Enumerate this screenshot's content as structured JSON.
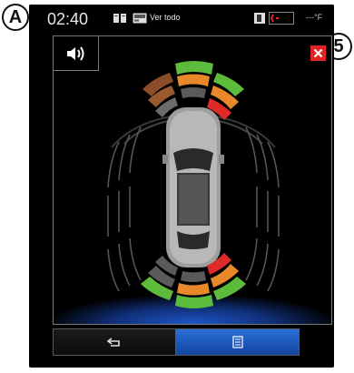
{
  "callouts": {
    "a": "A",
    "five": "5"
  },
  "status": {
    "time": "02:40",
    "view_all": "Ver todo",
    "temperature": "---°F"
  },
  "icons": {
    "sound": "speaker-icon",
    "close": "close-icon",
    "back": "back-arrow-icon",
    "list": "list-icon",
    "book": "book-icon",
    "media": "media-icon",
    "phone": "phone-icon",
    "signal": "signal-icon"
  },
  "colors": {
    "close": "#e22428",
    "green": "#5dbb3b",
    "orange": "#e8882a",
    "red": "#e02a2a",
    "accent": "#2a6fd6"
  },
  "sensor_levels": {
    "front": [
      "orange",
      "green",
      "orange",
      "red"
    ],
    "rear": [
      "gray",
      "green",
      "orange",
      "red"
    ]
  }
}
